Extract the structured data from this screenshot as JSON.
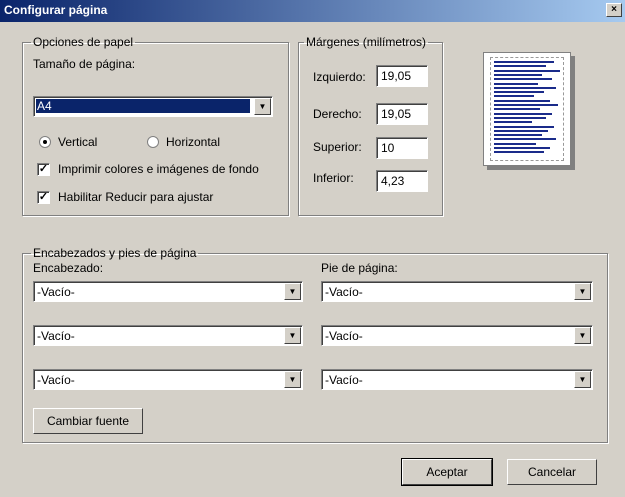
{
  "window": {
    "title": "Configurar página",
    "close_label": "×"
  },
  "paper": {
    "legend": "Opciones de papel",
    "size_label": "Tamaño de página:",
    "size_value": "A4",
    "portrait_label": "Vertical",
    "landscape_label": "Horizontal",
    "orientation_selected": "portrait",
    "print_bg_label": "Imprimir colores e imágenes de fondo",
    "print_bg_checked": true,
    "shrink_label": "Habilitar Reducir para ajustar",
    "shrink_checked": true
  },
  "margins": {
    "legend": "Márgenes (milímetros)",
    "left_label": "Izquierdo:",
    "left_value": "19,05",
    "right_label": "Derecho:",
    "right_value": "19,05",
    "top_label": "Superior:",
    "top_value": "10",
    "bottom_label": "Inferior:",
    "bottom_value": "4,23"
  },
  "headers_footers": {
    "legend": "Encabezados y pies de página",
    "header_label": "Encabezado:",
    "footer_label": "Pie de página:",
    "header_values": [
      "-Vacío-",
      "-Vacío-",
      "-Vacío-"
    ],
    "footer_values": [
      "-Vacío-",
      "-Vacío-",
      "-Vacío-"
    ],
    "change_font_label": "Cambiar fuente"
  },
  "buttons": {
    "ok": "Aceptar",
    "cancel": "Cancelar"
  },
  "icons": {
    "dropdown": "chevron-down-icon",
    "close": "close-icon"
  }
}
